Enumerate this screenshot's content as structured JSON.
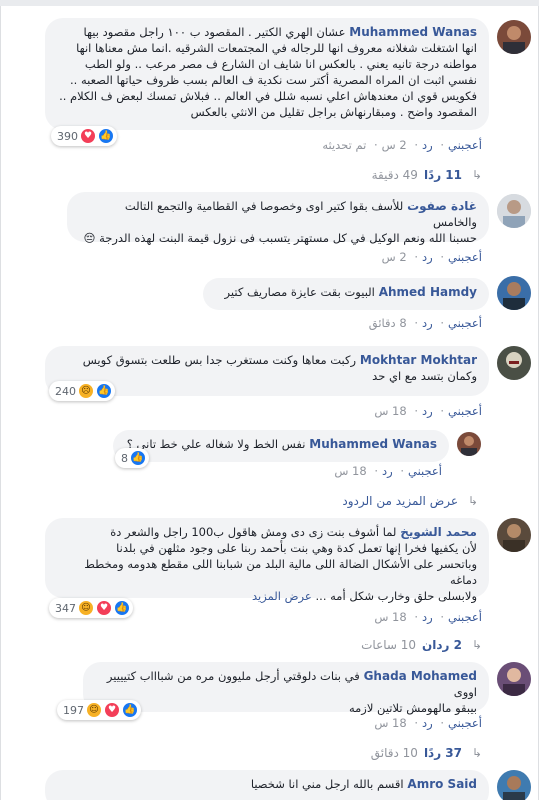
{
  "colors": {
    "link": "#385898",
    "bubble": "#f2f3f5",
    "meta": "#90949c",
    "like": "#1877f2",
    "love": "#f33e58",
    "haha": "#f7b125"
  },
  "comments": [
    {
      "name": "Muhammed Wanas",
      "lines": [
        "عشان الهري الكتير . المقصود ب ١٠٠ راجل مقصود بيها",
        "انها اشتغلت شغلانه معروف انها للرجاله في المجتمعات الشرقيه .انما مش معناها انها",
        "مواطنه درجة تانيه يعني . بالعكس انا شايف ان الشارع ف مصر مرعب .. ولو الطب",
        "نفسي اثبت ان المراه المصرية أكتر ست نكدية ف العالم بسب ظروف حياتها الصعبه ..",
        "فكويس قوي ان معندهاش اعلي نسبه شلل في العالم .. فبلاش تمسك لبعض ف الكلام ..",
        "المقصود واضح . ومبقارنهاش براجل تقليل من الانثي بالعكس"
      ],
      "reaction_count": "390",
      "actions": {
        "like": "أعجبني",
        "reply": "رد",
        "time": "2 س",
        "edited": "تم تحديثه"
      }
    },
    {
      "name": "غادة صفوت",
      "lines": [
        "للأسف بقوا كتير اوى وخصوصا في القطامية والتجمع التالت والخامس",
        "حسبنا الله ونعم الوكيل في كل مستهتر يتسبب فى نزول قيمة البنت لهذه الدرجة 😔"
      ],
      "actions": {
        "like": "أعجبني",
        "reply": "رد",
        "time": "2 س"
      }
    },
    {
      "name": "Ahmed Hamdy",
      "lines": [
        "البيوت بقت عايزة مصاريف كتير"
      ],
      "actions": {
        "like": "أعجبني",
        "reply": "رد",
        "time": "8 دقائق"
      }
    },
    {
      "name": "Mokhtar Mokhtar",
      "lines": [
        "ركبت معاها وكنت مستغرب جدا بس طلعت بتسوق كويس",
        "وكمان بتسد مع اي حد"
      ],
      "reaction_count": "240",
      "actions": {
        "like": "أعجبني",
        "reply": "رد",
        "time": "18 س"
      }
    },
    {
      "name": "Muhammed Wanas",
      "lines": [
        "نفس الخط ولا شغاله علي خط تاني ؟"
      ],
      "reaction_count": "8",
      "actions": {
        "like": "أعجبني",
        "reply": "رد",
        "time": "18 س"
      }
    },
    {
      "name": "محمد الشويخ",
      "lines": [
        "لما أشوف بنت زى دى ومش هاقول ب100 راجل والشعر دة",
        "لأن يكفيها فخرا إنها تعمل كدة وهي بنت بأحمد ربنا على وجود مثلهن في بلدنا",
        "وباتحسر على الأشكال الضالة اللى مالية البلد من شبابنا اللى مقطع هدومه ومخطط دماغه",
        "ولابسلى حلق وخارب شكل أمه ..."
      ],
      "see_more": "عرض المزيد",
      "reaction_count": "347",
      "actions": {
        "like": "أعجبني",
        "reply": "رد",
        "time": "18 س"
      }
    },
    {
      "name": "Ghada Mohamed",
      "lines": [
        "في بنات دلوقتي أرجل مليوون مره من شباااب كتيييير اووى",
        "بيبقو مالهومش تلاتين لازمه"
      ],
      "reaction_count": "197",
      "actions": {
        "like": "أعجبني",
        "reply": "رد",
        "time": "18 س"
      }
    },
    {
      "name": "Amro Said",
      "lines": [
        "اقسم بالله ارجل مني انا شخصيا"
      ],
      "actions": {}
    }
  ],
  "replies_1": {
    "count": "11 ردًا",
    "time": "49 دقيقة"
  },
  "more_replies": "عرض المزيد من الردود",
  "replies_6": {
    "count": "2 ردان",
    "time": "10 ساعات"
  },
  "replies_7": {
    "count": "37 ردًا",
    "time": "10 دقائق"
  }
}
